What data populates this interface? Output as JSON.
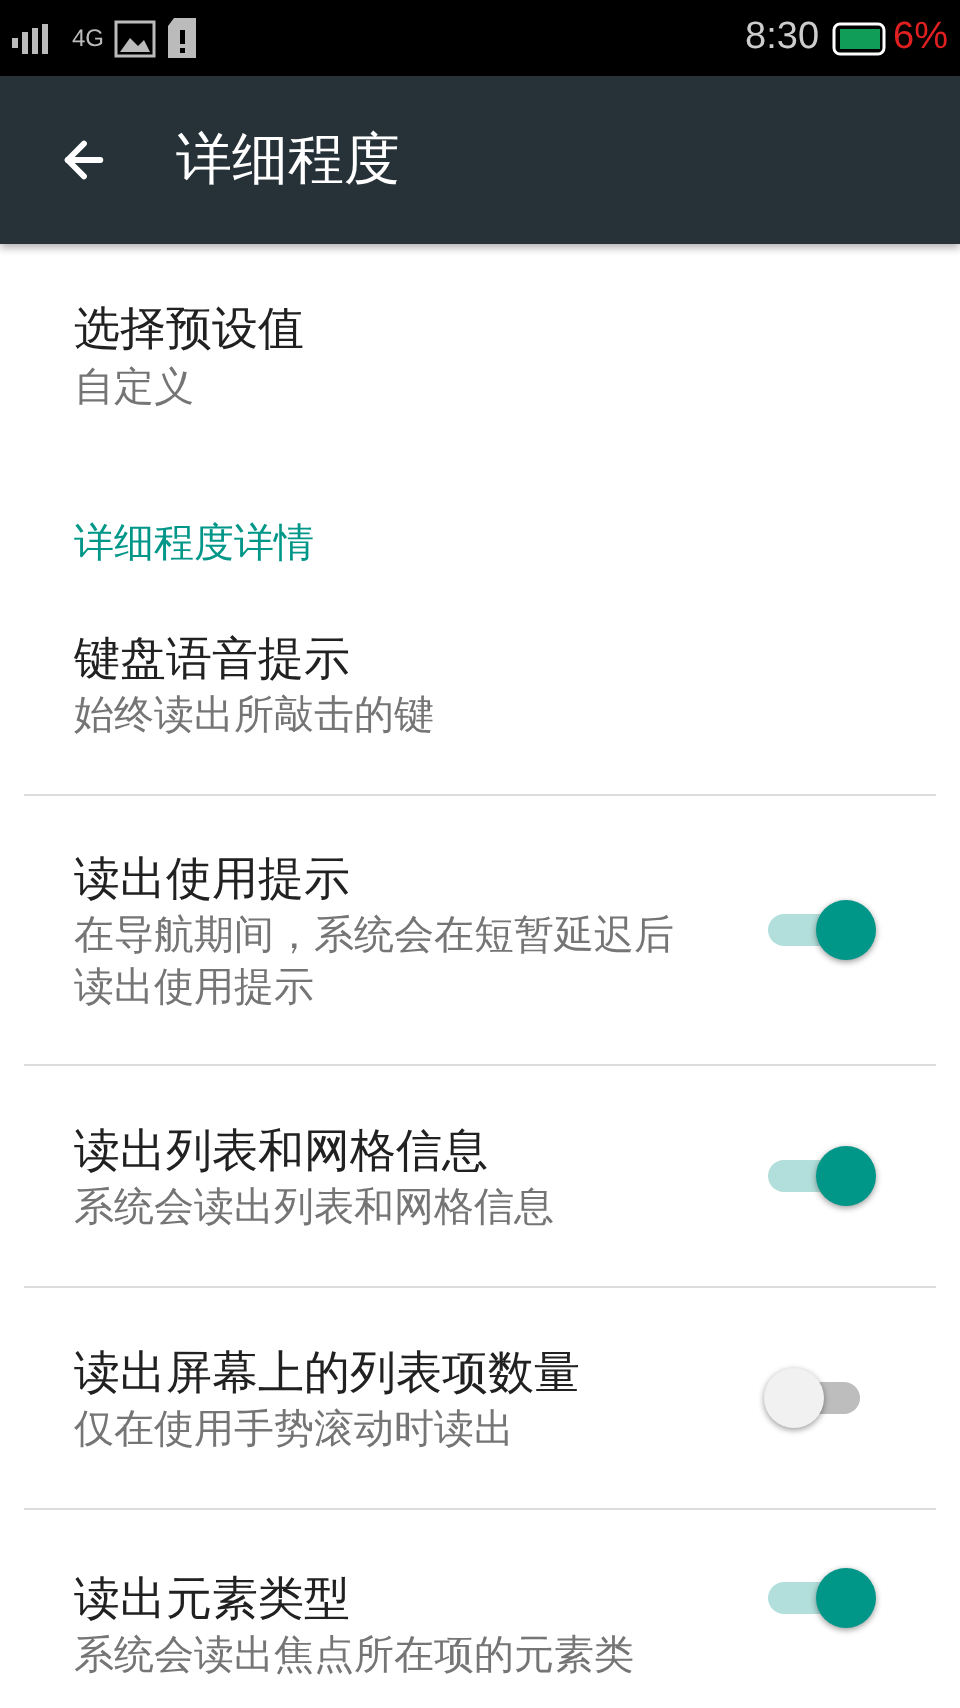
{
  "status_bar": {
    "network": "4G",
    "time": "8:30",
    "battery": "6%"
  },
  "app_bar": {
    "title": "详细程度"
  },
  "preset": {
    "title": "选择预设值",
    "summary": "自定义"
  },
  "section": {
    "title": "详细程度详情"
  },
  "items": [
    {
      "kind": "plain",
      "title": "键盘语音提示",
      "summary": "始终读出所敲击的键"
    },
    {
      "kind": "switch",
      "title": "读出使用提示",
      "summary": "在导航期间，系统会在短暂延迟后读出使用提示",
      "on": true
    },
    {
      "kind": "switch",
      "title": "读出列表和网格信息",
      "summary": "系统会读出列表和网格信息",
      "on": true
    },
    {
      "kind": "switch",
      "title": "读出屏幕上的列表项数量",
      "summary": "仅在使用手势滚动时读出",
      "on": false
    },
    {
      "kind": "switch",
      "title": "读出元素类型",
      "summary": "系统会读出焦点所在项的元素类",
      "on": true
    }
  ]
}
